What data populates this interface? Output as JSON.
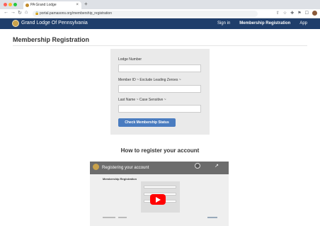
{
  "browser": {
    "tab_title": "PA Grand Lodge",
    "tab_close": "×",
    "new_tab": "+",
    "url": "portal.pamasons.org/membership_registration"
  },
  "sitenav": {
    "brand": "Grand Lodge Of Pennsylvania",
    "links": [
      "Sign in",
      "Membership Registration",
      "App"
    ]
  },
  "page": {
    "title": "Membership Registration",
    "form": {
      "lodge_label": "Lodge Number",
      "lodge_value": "",
      "member_label": "Member ID ~ Exclude Leading Zeroes ~",
      "member_value": "",
      "lastname_label": "Last Name ~ Case Sensitive ~",
      "lastname_value": "",
      "submit_label": "Check Membership Status"
    },
    "howto_heading": "How to register your account",
    "video": {
      "title": "Registering your account",
      "inner_heading": "Membership Registration"
    }
  },
  "icons": {
    "back": "←",
    "forward": "→",
    "reload": "↻",
    "home": "⌂",
    "lock": "🔒",
    "share": "↗",
    "toolbar": [
      "⇧",
      "☆",
      "✚",
      "⚑",
      "☐"
    ]
  }
}
